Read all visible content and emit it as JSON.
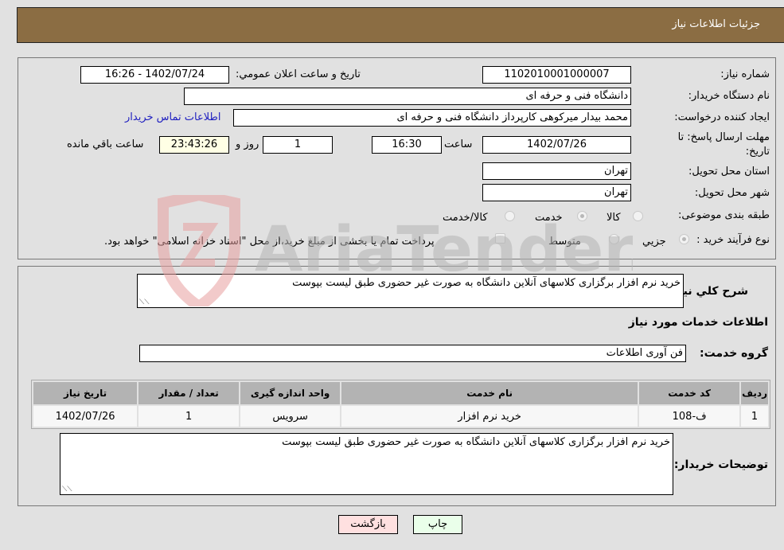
{
  "header": {
    "title": "جزئیات اطلاعات نیاز"
  },
  "form": {
    "need_number": {
      "label": "شماره نیاز:",
      "value": "1102010001000007"
    },
    "announce_datetime": {
      "label": "تاریخ و ساعت اعلان عمومي:",
      "value": "1402/07/24 - 16:26"
    },
    "buyer_org": {
      "label": "نام دستگاه خریدار:",
      "value": "دانشگاه فنی و حرفه ای"
    },
    "requester": {
      "label": "ایجاد کننده درخواست:",
      "value": "محمد بیدار میرکوهی کارپرداز دانشگاه فنی و حرفه ای"
    },
    "buyer_contact_link": "اطلاعات تماس خریدار",
    "deadline": {
      "label_line1": "مهلت ارسال پاسخ: تا",
      "label_line2": "تاریخ:",
      "date": "1402/07/26",
      "time_label": "ساعت",
      "time": "16:30",
      "days": "1",
      "days_label": "روز و",
      "remaining": "23:43:26",
      "remaining_label": "ساعت باقي مانده"
    },
    "province": {
      "label": "استان محل تحویل:",
      "value": "تهران"
    },
    "city": {
      "label": "شهر محل تحویل:",
      "value": "تهران"
    },
    "category": {
      "label": "طبقه بندی موضوعی:",
      "options": [
        "کالا",
        "خدمت",
        "کالا/خدمت"
      ],
      "selected": "خدمت"
    },
    "purchase_type": {
      "label": "نوع فرآیند خرید :",
      "options": [
        "جزيي",
        "متوسط"
      ],
      "selected": "جزيي",
      "treasury_note": "پرداخت تمام یا بخشی از مبلغ خرید،از محل \"اسناد خزانه اسلامی\" خواهد بود."
    }
  },
  "details": {
    "description_label": "شرح کلي نیاز:",
    "description": "خرید نرم افزار برگزاری کلاسهای آنلاین دانشگاه به صورت غیر حضوری طبق لیست بپوست",
    "services_heading": "اطلاعات خدمات مورد نیاز",
    "service_group_label": "گروه خدمت:",
    "service_group": "فن آوری اطلاعات",
    "table": {
      "headers": [
        "ردیف",
        "کد خدمت",
        "نام خدمت",
        "واحد اندازه گیری",
        "تعداد / مقدار",
        "تاریخ نیاز"
      ],
      "rows": [
        [
          "1",
          "ف-108",
          "خرید نرم افزار",
          "سرویس",
          "1",
          "1402/07/26"
        ]
      ]
    },
    "buyer_notes_label": "توضیحات خریدار:",
    "buyer_notes": "خرید نرم افزار برگزاری کلاسهای آنلاین دانشگاه به صورت غیر حضوری طبق لیست بپوست"
  },
  "buttons": {
    "print": "چاپ",
    "back": "بازگشت"
  },
  "watermark": "AriaTender.neT"
}
